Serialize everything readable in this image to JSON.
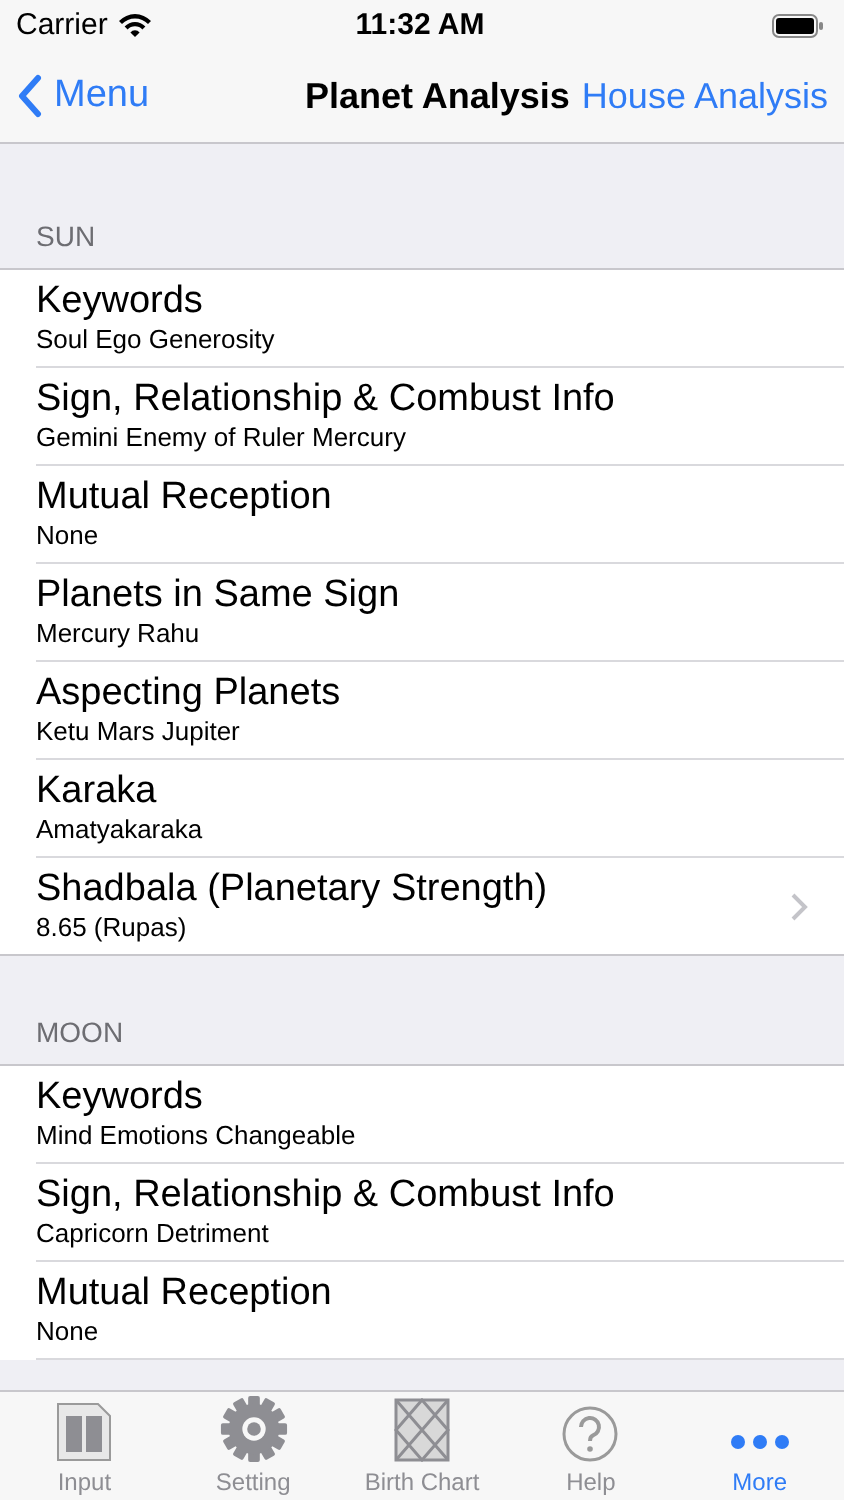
{
  "status_bar": {
    "carrier": "Carrier",
    "time": "11:32 AM"
  },
  "nav": {
    "back_label": "Menu",
    "title": "Planet Analysis",
    "right_button": "House Analysis"
  },
  "sections": [
    {
      "title": "SUN",
      "rows": [
        {
          "title": "Keywords",
          "subtitle": "Soul Ego Generosity",
          "disclosure": false
        },
        {
          "title": "Sign, Relationship & Combust Info",
          "subtitle": "Gemini Enemy of Ruler Mercury",
          "disclosure": false
        },
        {
          "title": "Mutual Reception",
          "subtitle": "None",
          "disclosure": false
        },
        {
          "title": "Planets in Same Sign",
          "subtitle": "Mercury Rahu",
          "disclosure": false
        },
        {
          "title": "Aspecting Planets",
          "subtitle": "Ketu Mars Jupiter",
          "disclosure": false
        },
        {
          "title": "Karaka",
          "subtitle": "Amatyakaraka",
          "disclosure": false
        },
        {
          "title": "Shadbala (Planetary Strength)",
          "subtitle": "8.65 (Rupas)",
          "disclosure": true
        }
      ]
    },
    {
      "title": "MOON",
      "rows": [
        {
          "title": "Keywords",
          "subtitle": "Mind Emotions Changeable",
          "disclosure": false
        },
        {
          "title": "Sign, Relationship & Combust Info",
          "subtitle": "Capricorn Detriment",
          "disclosure": false
        },
        {
          "title": "Mutual Reception",
          "subtitle": "None",
          "disclosure": false
        }
      ]
    }
  ],
  "tabs": [
    {
      "kind": "input",
      "label": "Input",
      "selected": false
    },
    {
      "kind": "setting",
      "label": "Setting",
      "selected": false
    },
    {
      "kind": "chart",
      "label": "Birth Chart",
      "selected": false
    },
    {
      "kind": "help",
      "label": "Help",
      "selected": false
    },
    {
      "kind": "more",
      "label": "More",
      "selected": true
    }
  ]
}
